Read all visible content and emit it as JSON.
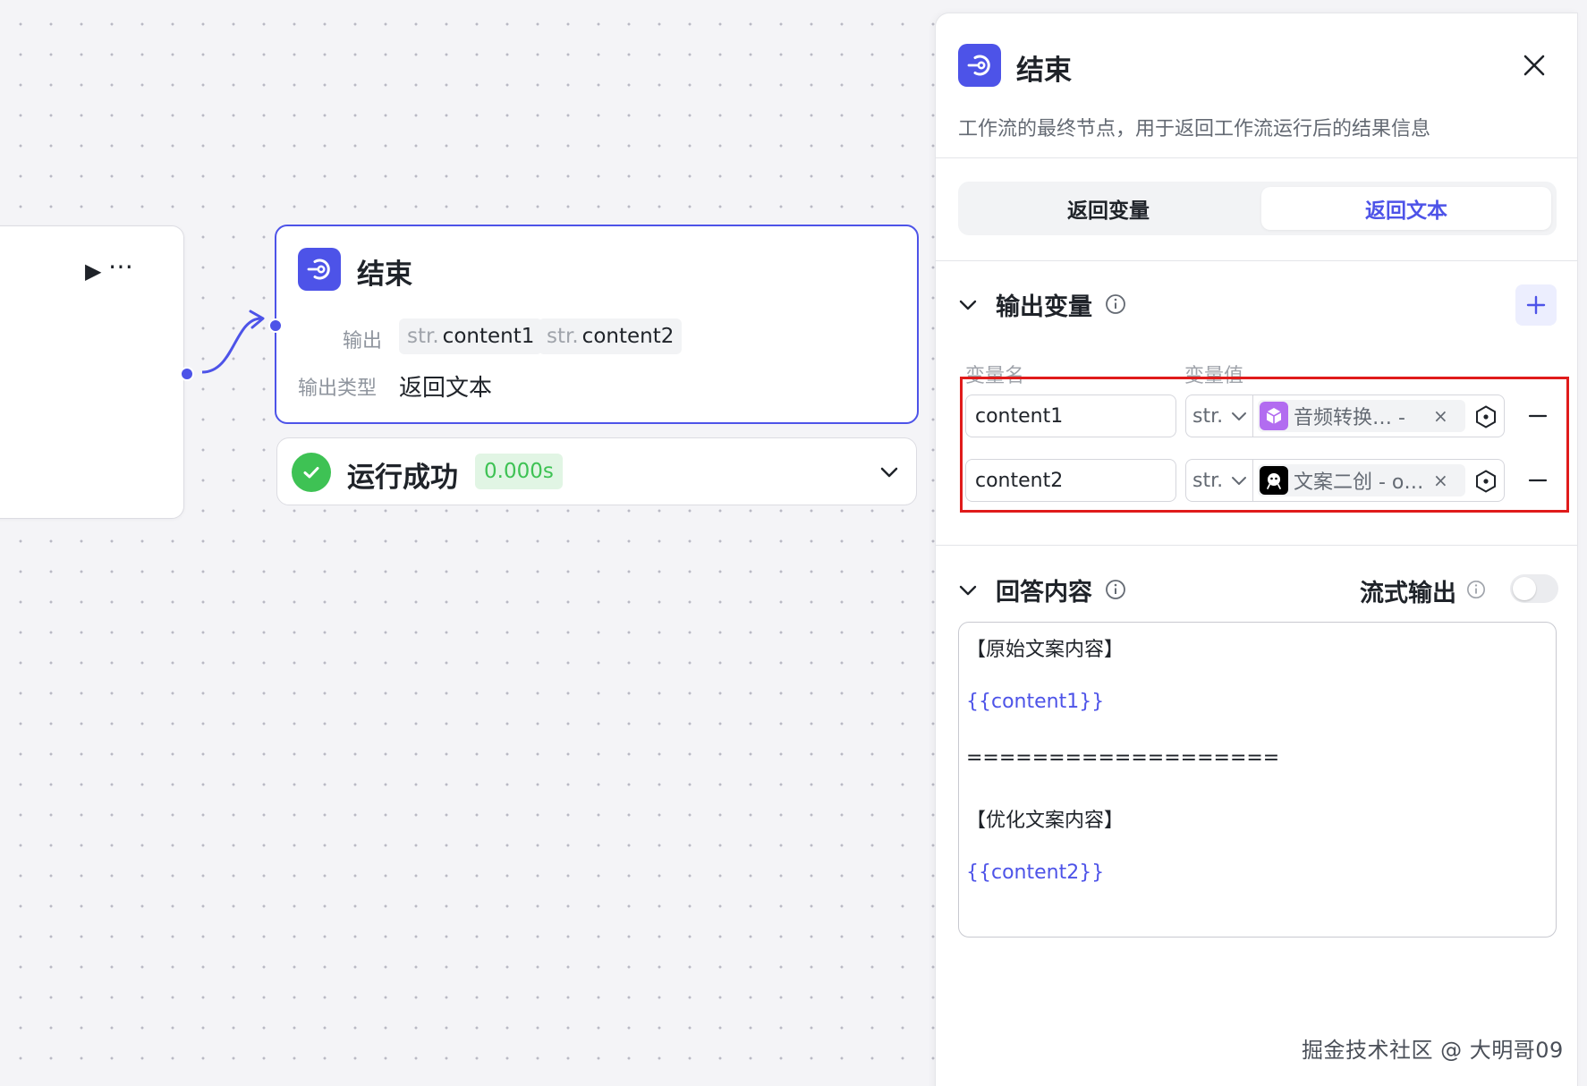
{
  "canvas": {
    "end_node": {
      "title": "结束",
      "output_label": "输出",
      "outputs": [
        {
          "type": "str.",
          "name": "content1"
        },
        {
          "type": "str.",
          "name": "content2"
        }
      ],
      "output_type_label": "输出类型",
      "output_type_value": "返回文本"
    },
    "status": {
      "text": "运行成功",
      "duration": "0.000s"
    }
  },
  "panel": {
    "title": "结束",
    "description": "工作流的最终节点，用于返回工作流运行后的结果信息",
    "tabs": [
      {
        "label": "返回变量",
        "active": false
      },
      {
        "label": "返回文本",
        "active": true
      }
    ],
    "output_vars": {
      "section_title": "输出变量",
      "col_name": "变量名",
      "col_value": "变量值",
      "rows": [
        {
          "name": "content1",
          "type": "str.",
          "ref": "音频转换… - ",
          "ref_icon": "cube-icon",
          "ref_icon_color": "#b26cf0"
        },
        {
          "name": "content2",
          "type": "str.",
          "ref": "文案二创 - o…",
          "ref_icon": "bot-icon",
          "ref_icon_color": "#000000"
        }
      ]
    },
    "answer": {
      "section_title": "回答内容",
      "stream_label": "流式输出",
      "stream_enabled": false,
      "lines": [
        {
          "text": "【原始文案内容】",
          "var": false
        },
        {
          "text": "{{content1}}",
          "var": true
        },
        {
          "text": "===================",
          "var": false
        },
        {
          "text": "【优化文案内容】",
          "var": false
        },
        {
          "text": "{{content2}}",
          "var": true
        }
      ]
    }
  },
  "watermark": "掘金技术社区 @ 大明哥09",
  "colors": {
    "accent": "#4d53e8",
    "success": "#3ec254",
    "highlight_box": "#e01b1b"
  }
}
